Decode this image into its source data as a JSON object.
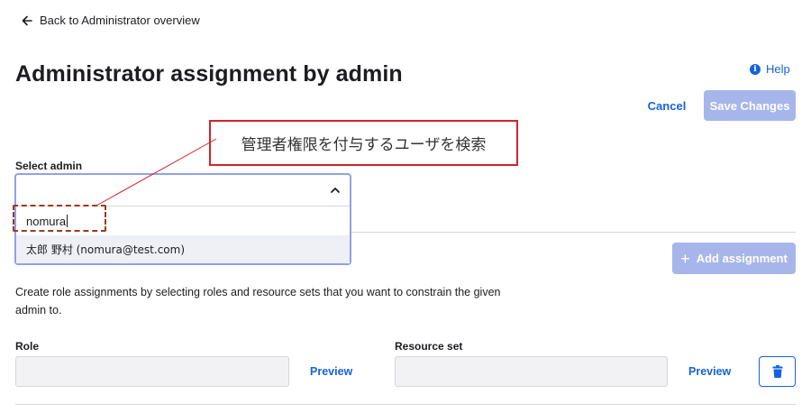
{
  "nav": {
    "back_label": "Back to Administrator overview"
  },
  "header": {
    "title": "Administrator assignment by admin",
    "help_label": "Help",
    "help_icon": "info-icon"
  },
  "actions": {
    "cancel_label": "Cancel",
    "save_label": "Save Changes"
  },
  "annotation": {
    "text": "管理者権限を付与するユーザを検索"
  },
  "admin_select": {
    "label": "Select admin",
    "search_value": "nomura",
    "options": [
      {
        "label": "太郎 野村 (nomura@test.com)"
      }
    ]
  },
  "assignments": {
    "add_label": "Add assignment",
    "add_icon": "+",
    "description": "Create role assignments by selecting roles and resource sets that you want to constrain the given admin to.",
    "role_label": "Role",
    "resource_label": "Resource set",
    "preview_label": "Preview"
  },
  "colors": {
    "primary_link": "#1662dd",
    "disabled_button": "#a7b6ea",
    "annotation_red": "#d2232a",
    "highlight_brown": "#9b3b1b"
  }
}
